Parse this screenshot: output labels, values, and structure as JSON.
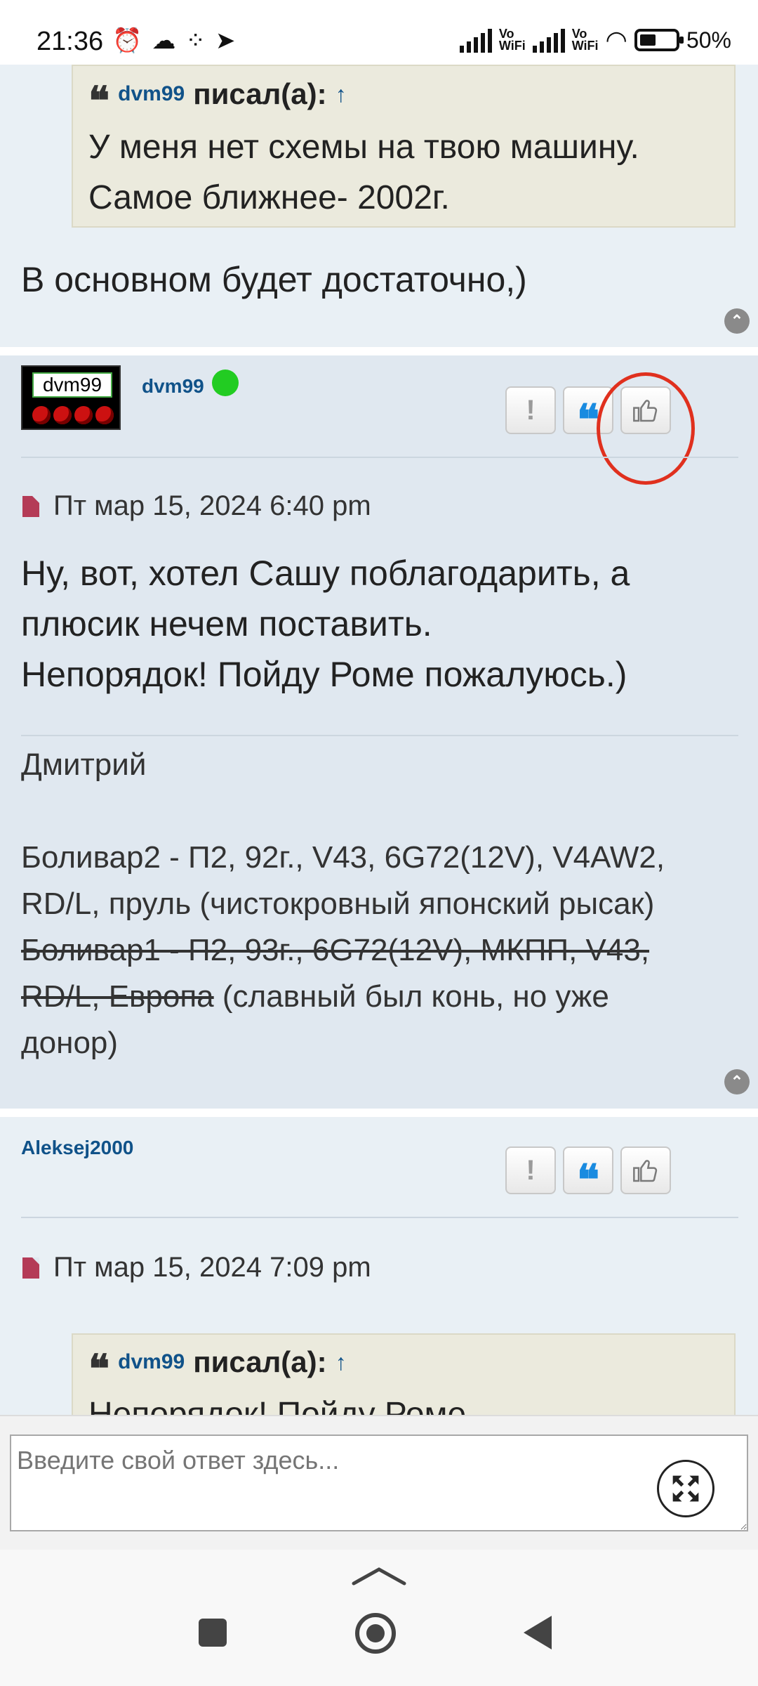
{
  "status_bar": {
    "time": "21:36",
    "battery_text": "50%",
    "network_label": "Vo\nWiFi",
    "icons_left": [
      "alarm-icon",
      "cloud-icon",
      "dots-icon",
      "telegram-icon"
    ],
    "icons_right": [
      "signal-icon",
      "wifi-icon",
      "battery-icon"
    ]
  },
  "posts": [
    {
      "quote": {
        "author": "dvm99",
        "wrote": "писал(а):",
        "arrow": "↑",
        "lines": [
          "У меня нет схемы на твою машину.",
          "Самое ближнее- 2002г."
        ]
      },
      "body": "В основном будет достаточно,)"
    },
    {
      "author": "dvm99",
      "avatar_text": "dvm99",
      "date": "Пт мар 15, 2024 6:40 pm",
      "body_lines": [
        "Ну, вот, хотел Сашу поблагодарить, а",
        "плюсик нечем поставить.",
        "Непорядок! Пойду Роме пожалуюсь.)"
      ],
      "signature": {
        "name": "Дмитрий",
        "line1": "Боливар2 - П2, 92г., V43, 6G72(12V), V4AW2,",
        "line2": "RD/L, пруль (чистокровный японский рысак)",
        "line3_strike": "Боливар1 - П2, 93г., 6G72(12V), МКПП, V43,",
        "line4_strike": "RD/L, Европа",
        "line4_rest": " (славный был конь, но уже",
        "line5": "донор)"
      }
    },
    {
      "author": "Aleksej2000",
      "date": "Пт мар 15, 2024 7:09 pm",
      "quote": {
        "author": "dvm99",
        "wrote": "писал(а):",
        "arrow": "↑",
        "partial_line": "Непорядок! Пойду Роме"
      }
    }
  ],
  "action_buttons": {
    "report": "!",
    "quote": "❝",
    "like": "👍"
  },
  "reply": {
    "placeholder": "Введите свой ответ здесь..."
  },
  "accent_colors": {
    "username": "#105289",
    "online": "#22cc22",
    "annotation": "#e0301e"
  }
}
